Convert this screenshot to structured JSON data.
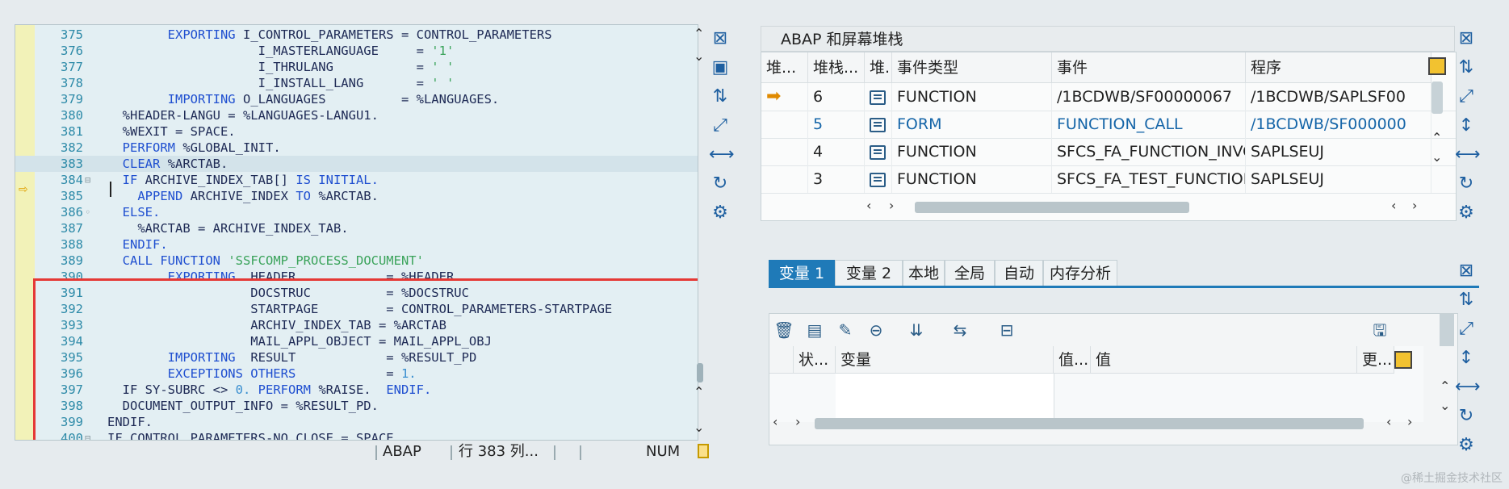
{
  "editor": {
    "lines": [
      {
        "n": "375",
        "fold": "",
        "code": [
          {
            "t": "        "
          },
          {
            "t": "EXPORTING",
            "c": "kw"
          },
          {
            "t": " I_CONTROL_PARAMETERS = CONTROL_PARAMETERS"
          }
        ]
      },
      {
        "n": "376",
        "fold": "",
        "code": [
          {
            "t": "                    I_MASTERLANGUAGE     = "
          },
          {
            "t": "'1'",
            "c": "str"
          }
        ]
      },
      {
        "n": "377",
        "fold": "",
        "code": [
          {
            "t": "                    I_THRULANG           = "
          },
          {
            "t": "' '",
            "c": "str"
          }
        ]
      },
      {
        "n": "378",
        "fold": "",
        "code": [
          {
            "t": "                    I_INSTALL_LANG       = "
          },
          {
            "t": "' '",
            "c": "str"
          }
        ]
      },
      {
        "n": "379",
        "fold": "",
        "code": [
          {
            "t": "        "
          },
          {
            "t": "IMPORTING",
            "c": "kw"
          },
          {
            "t": " O_LANGUAGES          = %LANGUAGES."
          }
        ]
      },
      {
        "n": "380",
        "fold": "",
        "code": [
          {
            "t": "  %HEADER-LANGU = %LANGUAGES-LANGU1."
          }
        ]
      },
      {
        "n": "381",
        "fold": "",
        "code": [
          {
            "t": "  %WEXIT = SPACE."
          }
        ]
      },
      {
        "n": "382",
        "fold": "",
        "code": [
          {
            "t": "  "
          },
          {
            "t": "PERFORM",
            "c": "kw"
          },
          {
            "t": " %GLOBAL_INIT."
          }
        ]
      },
      {
        "n": "383",
        "fold": "",
        "code": [
          {
            "t": "  "
          },
          {
            "t": "CLEAR",
            "c": "kw"
          },
          {
            "t": " %ARCTAB."
          }
        ],
        "current": true
      },
      {
        "n": "384",
        "fold": "⊟",
        "code": [
          {
            "t": "  "
          },
          {
            "t": "IF",
            "c": "kw"
          },
          {
            "t": " ARCHIVE_INDEX_TAB[] "
          },
          {
            "t": "IS INITIAL.",
            "c": "kw"
          }
        ]
      },
      {
        "n": "385",
        "fold": "",
        "code": [
          {
            "t": "    "
          },
          {
            "t": "APPEND",
            "c": "kw"
          },
          {
            "t": " ARCHIVE_INDEX "
          },
          {
            "t": "TO",
            "c": "kw"
          },
          {
            "t": " %ARCTAB."
          }
        ]
      },
      {
        "n": "386",
        "fold": "◦",
        "code": [
          {
            "t": "  "
          },
          {
            "t": "ELSE.",
            "c": "kw"
          }
        ]
      },
      {
        "n": "387",
        "fold": "",
        "code": [
          {
            "t": "    %ARCTAB = ARCHIVE_INDEX_TAB."
          }
        ]
      },
      {
        "n": "388",
        "fold": "",
        "code": [
          {
            "t": "  "
          },
          {
            "t": "ENDIF.",
            "c": "kw"
          }
        ]
      },
      {
        "n": "389",
        "fold": "",
        "code": [
          {
            "t": "  "
          },
          {
            "t": "CALL FUNCTION",
            "c": "kw"
          },
          {
            "t": " "
          },
          {
            "t": "'SSFCOMP_PROCESS_DOCUMENT'",
            "c": "str"
          }
        ]
      },
      {
        "n": "390",
        "fold": "",
        "code": [
          {
            "t": "        "
          },
          {
            "t": "EXPORTING",
            "c": "kw"
          },
          {
            "t": "  HEADER            = %HEADER"
          }
        ]
      },
      {
        "n": "391",
        "fold": "",
        "code": [
          {
            "t": "                   DOCSTRUC          = %DOCSTRUC"
          }
        ]
      },
      {
        "n": "392",
        "fold": "",
        "code": [
          {
            "t": "                   STARTPAGE         = CONTROL_PARAMETERS-STARTPAGE"
          }
        ]
      },
      {
        "n": "393",
        "fold": "",
        "code": [
          {
            "t": "                   ARCHIV_INDEX_TAB = %ARCTAB"
          }
        ]
      },
      {
        "n": "394",
        "fold": "",
        "code": [
          {
            "t": "                   MAIL_APPL_OBJECT = MAIL_APPL_OBJ"
          }
        ]
      },
      {
        "n": "395",
        "fold": "",
        "code": [
          {
            "t": "        "
          },
          {
            "t": "IMPORTING",
            "c": "kw"
          },
          {
            "t": "  RESULT            = %RESULT_PD"
          }
        ]
      },
      {
        "n": "396",
        "fold": "",
        "code": [
          {
            "t": "        "
          },
          {
            "t": "EXCEPTIONS OTHERS",
            "c": "kw"
          },
          {
            "t": "            = "
          },
          {
            "t": "1.",
            "c": "num"
          }
        ]
      },
      {
        "n": "397",
        "fold": "",
        "code": [
          {
            "t": "  IF SY-SUBRC <> "
          },
          {
            "t": "0.",
            "c": "num"
          },
          {
            "t": " "
          },
          {
            "t": "PERFORM",
            "c": "kw"
          },
          {
            "t": " %RAISE.  "
          },
          {
            "t": "ENDIF.",
            "c": "kw"
          }
        ]
      },
      {
        "n": "398",
        "fold": "",
        "code": [
          {
            "t": "  DOCUMENT_OUTPUT_INFO = %RESULT_PD."
          }
        ]
      },
      {
        "n": "399",
        "fold": "",
        "code": [
          {
            "t": "ENDIF."
          }
        ]
      },
      {
        "n": "400",
        "fold": "⊟",
        "code": [
          {
            "t": "IF CONTROL_PARAMETERS-NO_CLOSE = SPACE."
          }
        ]
      }
    ],
    "status": {
      "lang": "ABAP",
      "position": "行 383 列...",
      "mode": "NUM"
    }
  },
  "stack": {
    "title": "ABAP 和屏幕堆栈",
    "columns": [
      "堆...",
      "堆栈...",
      "堆.",
      "事件类型",
      "事件",
      "程序"
    ],
    "rows": [
      {
        "level": "6",
        "type": "FUNCTION",
        "event": "/1BCDWB/SF00000067",
        "program": "/1BCDWB/SAPLSF00",
        "active": true,
        "highlight": false
      },
      {
        "level": "5",
        "type": "FORM",
        "event": "FUNCTION_CALL",
        "program": "/1BCDWB/SF000000",
        "active": false,
        "highlight": true
      },
      {
        "level": "4",
        "type": "FUNCTION",
        "event": "SFCS_FA_FUNCTION_INVO...",
        "program": "SAPLSEUJ",
        "active": false,
        "highlight": false
      },
      {
        "level": "3",
        "type": "FUNCTION",
        "event": "SFCS_FA_TEST_FUNCTION",
        "program": "SAPLSEUJ",
        "active": false,
        "highlight": false
      }
    ]
  },
  "variables": {
    "tabs": [
      "变量 1",
      "变量 2",
      "本地",
      "全局",
      "自动",
      "内存分析"
    ],
    "active_tab": 0,
    "columns": [
      "状...",
      "变量",
      "值...",
      "值",
      "更..."
    ]
  },
  "watermark": "@稀土掘金技术社区",
  "colors": {
    "accent": "#1f7ab8",
    "highlight_box": "#e53935",
    "keyword": "#1f4fd0",
    "string": "#3aa35a"
  }
}
